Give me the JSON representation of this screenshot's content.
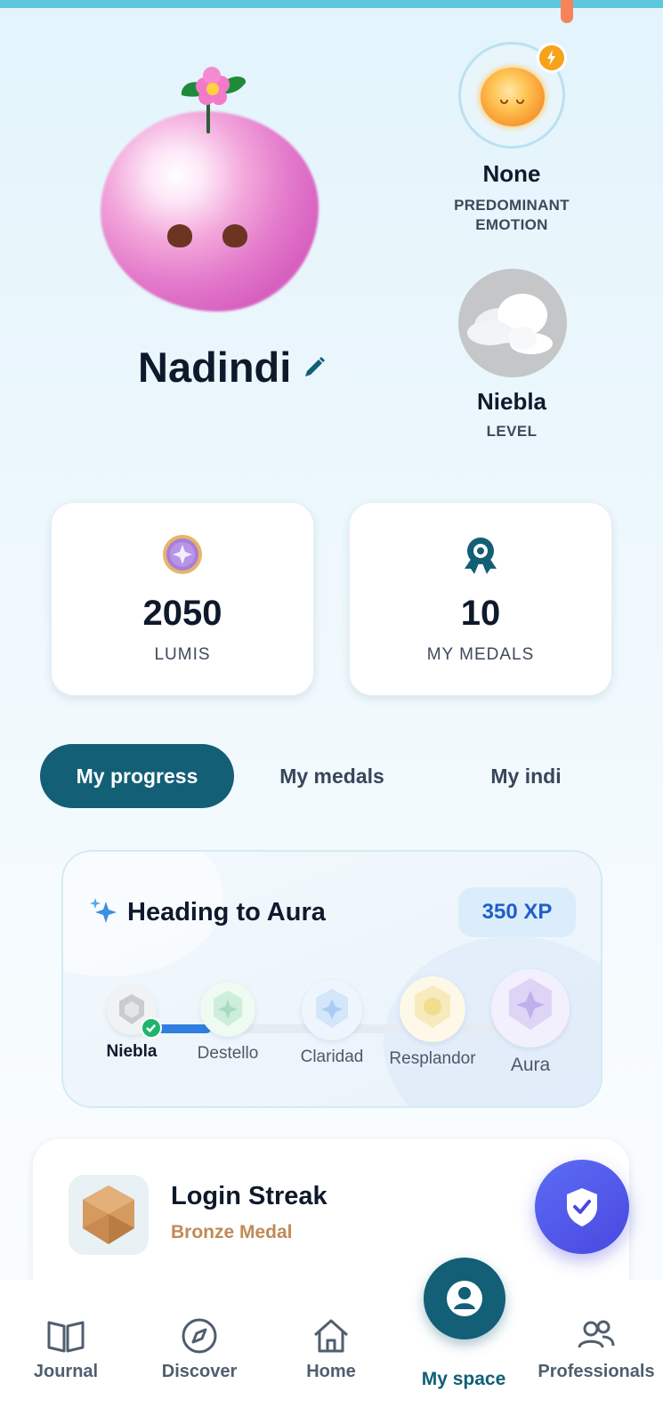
{
  "profile": {
    "name": "Nadindi"
  },
  "emotion": {
    "value": "None",
    "label_line1": "PREDOMINANT",
    "label_line2": "EMOTION"
  },
  "level": {
    "value": "Niebla",
    "label": "LEVEL"
  },
  "stats": [
    {
      "value": "2050",
      "label": "LUMIS",
      "icon": "lumis-coin-icon"
    },
    {
      "value": "10",
      "label": "MY MEDALS",
      "icon": "medal-ribbon-icon"
    }
  ],
  "tabs": [
    {
      "label": "My progress",
      "active": true
    },
    {
      "label": "My medals",
      "active": false
    },
    {
      "label": "My indi",
      "active": false
    }
  ],
  "progress": {
    "title": "Heading to Aura",
    "xp": "350 XP",
    "fill_fraction": 0.14,
    "stages": [
      {
        "label": "Niebla",
        "current": true
      },
      {
        "label": "Destello"
      },
      {
        "label": "Claridad"
      },
      {
        "label": "Resplandor"
      },
      {
        "label": "Aura"
      }
    ]
  },
  "streak": {
    "title": "Login Streak",
    "subtitle": "Bronze Medal"
  },
  "nav": [
    {
      "label": "Journal",
      "icon": "book-icon"
    },
    {
      "label": "Discover",
      "icon": "compass-icon"
    },
    {
      "label": "Home",
      "icon": "home-icon"
    },
    {
      "label": "My space",
      "icon": "user-circle-icon",
      "active": true
    },
    {
      "label": "Professionals",
      "icon": "people-icon"
    }
  ],
  "colors": {
    "primary": "#125f76",
    "accent_blue": "#2f7ee0",
    "fab": "#4a48e0",
    "bronze": "#c08a56"
  }
}
